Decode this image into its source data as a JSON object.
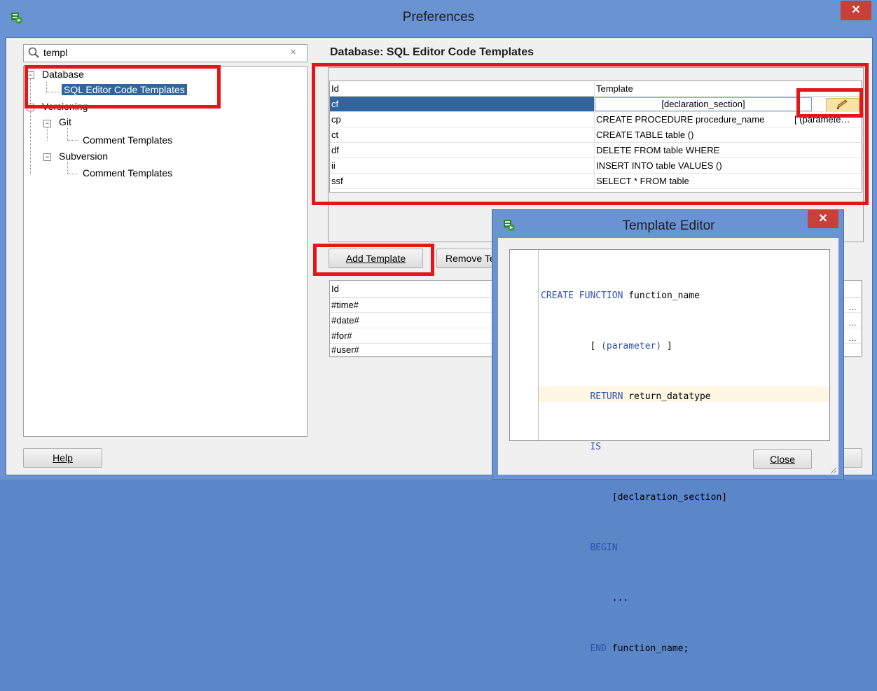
{
  "window": {
    "title": "Preferences",
    "close_glyph": "✕"
  },
  "search": {
    "value": "templ",
    "clear_glyph": "✕"
  },
  "tree": {
    "database": "Database",
    "sql_templates": "SQL Editor Code Templates",
    "versioning": "Versioning",
    "git": "Git",
    "git_comment": "Comment Templates",
    "subversion": "Subversion",
    "svn_comment": "Comment Templates"
  },
  "page_title": "Database: SQL Editor Code Templates",
  "templates_table": {
    "headers": [
      "Id",
      "Template"
    ],
    "rows": [
      [
        "cf",
        "[declaration_section]"
      ],
      [
        "cp",
        "CREATE PROCEDURE procedure_name"
      ],
      [
        "ct",
        "CREATE TABLE table ()"
      ],
      [
        "df",
        "DELETE FROM table WHERE"
      ],
      [
        "ii",
        "INSERT INTO table VALUES ()"
      ],
      [
        "ssf",
        "SELECT * FROM table"
      ]
    ],
    "cp_overflow": "[ (paramete…"
  },
  "buttons": {
    "add_template": "Add Template",
    "remove_template": "Remove Te",
    "help": "Help",
    "close": "Close"
  },
  "vars_table": {
    "header": "Id",
    "rows": [
      "#time#",
      "#date#",
      "#for#",
      "#user#"
    ],
    "overflow": [
      "…",
      "…",
      "…"
    ]
  },
  "editor": {
    "title": "Template Editor",
    "close_glyph": "✕",
    "lines": [
      [
        "CREATE FUNCTION",
        " function_name"
      ],
      [
        "         [ ",
        "(parameter)",
        " ]"
      ],
      [
        "         RETURN",
        " return_datatype"
      ],
      [
        "         IS",
        ""
      ],
      [
        "             [declaration_section]",
        ""
      ],
      [
        "         BEGIN",
        ""
      ],
      [
        "             ...",
        ""
      ],
      [
        "         END",
        " function_name;"
      ]
    ]
  },
  "colors": {
    "selection": "#33659c",
    "highlight_border": "#e2171e",
    "title_bar": "#6a93d4",
    "current_line": "#fdf6e3"
  }
}
